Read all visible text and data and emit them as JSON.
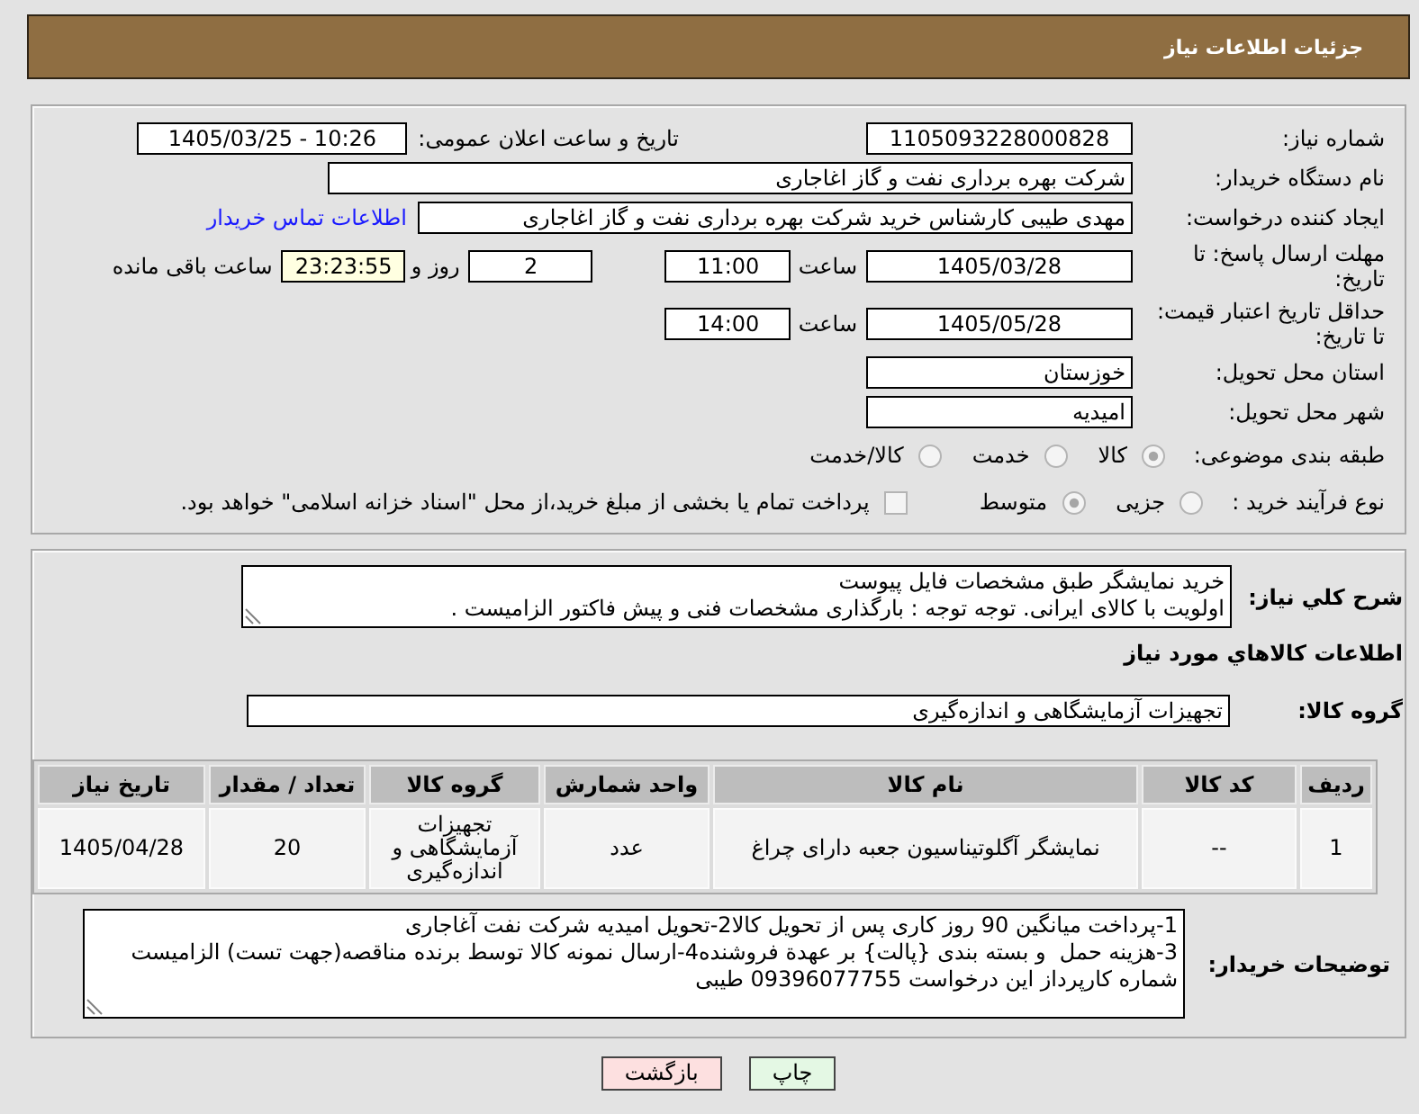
{
  "header": {
    "title": "جزئیات اطلاعات نیاز"
  },
  "details": {
    "need_number": {
      "label": "شماره نیاز:",
      "value": "1105093228000828"
    },
    "announce": {
      "label": "تاریخ و ساعت اعلان عمومی:",
      "value": "1405/03/25 - 10:26"
    },
    "buyer_org": {
      "label": "نام دستگاه خریدار:",
      "value": "شرکت بهره برداری نفت و گاز اغاجاری"
    },
    "requester": {
      "label": "ایجاد کننده درخواست:",
      "value": "مهدی طیبی کارشناس خرید شرکت بهره برداری نفت و گاز اغاجاری",
      "contact_link": "اطلاعات تماس خریدار"
    },
    "reply_deadline": {
      "label": "مهلت ارسال پاسخ: تا تاریخ:",
      "date": "1405/03/28",
      "time_label": "ساعت",
      "time": "11:00",
      "days": "2",
      "days_label": "روز و",
      "remaining": "23:23:55",
      "remaining_label": "ساعت باقی مانده"
    },
    "price_validity": {
      "label": "حداقل تاریخ اعتبار قیمت: تا تاریخ:",
      "date": "1405/05/28",
      "time_label": "ساعت",
      "time": "14:00"
    },
    "province": {
      "label": "استان محل تحویل:",
      "value": "خوزستان"
    },
    "city": {
      "label": "شهر محل تحویل:",
      "value": "امیدیه"
    },
    "category": {
      "label": "طبقه بندی موضوعی:",
      "options": [
        {
          "label": "کالا",
          "selected": true
        },
        {
          "label": "خدمت",
          "selected": false
        },
        {
          "label": "کالا/خدمت",
          "selected": false
        }
      ]
    },
    "process": {
      "label": "نوع فرآیند خرید :",
      "options": [
        {
          "label": "جزیی",
          "selected": false
        },
        {
          "label": "متوسط",
          "selected": true
        }
      ],
      "treasury": {
        "label": "پرداخت تمام یا بخشی از مبلغ خرید،از محل \"اسناد خزانه اسلامی\" خواهد بود.",
        "checked": false
      }
    }
  },
  "description": {
    "label": "شرح کلي نياز:",
    "value": "خرید نمایشگر طبق مشخصات فایل پیوست\nاولویت با کالای ایرانی. توجه توجه : بارگذاری مشخصات فنی و پیش فاکتور الزامیست ."
  },
  "goods": {
    "title": "اطلاعات کالاهاي مورد نياز",
    "group_label": "گروه کالا:",
    "group_value": "تجهیزات آزمایشگاهی و اندازه‌گیری",
    "table": {
      "columns": [
        "ردیف",
        "کد کالا",
        "نام کالا",
        "واحد شمارش",
        "گروه کالا",
        "تعداد / مقدار",
        "تاریخ نیاز"
      ],
      "rows": [
        [
          "1",
          "--",
          "نمایشگر آگلوتیناسیون جعبه دارای چراغ",
          "عدد",
          "تجهیزات آزمایشگاهی و اندازه‌گیری",
          "20",
          "1405/04/28"
        ]
      ]
    }
  },
  "buyer_notes": {
    "label": "توضیحات خریدار:",
    "value": "1-پرداخت میانگین 90 روز کاری پس از تحویل کالا2-تحویل امیدیه شرکت نفت آغاجاری\n3-هزینه حمل  و بسته بندی {پالت} بر عهدة فروشنده4-ارسال نمونه کالا توسط برنده مناقصه(جهت تست) الزامیست\nشماره کارپرداز این درخواست 09396077755 طیبی"
  },
  "buttons": [
    {
      "label": "چاپ",
      "kind": "print"
    },
    {
      "label": "بازگشت",
      "kind": "back"
    }
  ]
}
